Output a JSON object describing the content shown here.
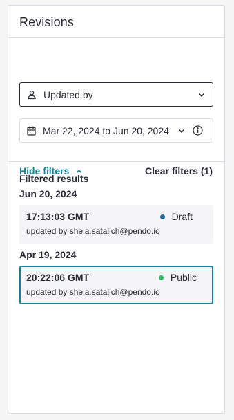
{
  "panel": {
    "title": "Revisions"
  },
  "filters": {
    "updated_by": {
      "label": "Updated by",
      "icon": "user-icon"
    },
    "date_range": {
      "label": "Mar 22, 2024 to Jun 20, 2024",
      "icon": "calendar-icon"
    },
    "hide_filters_label": "Hide filters",
    "clear_filters_label": "Clear filters (1)",
    "accent_color": "#128297"
  },
  "results": {
    "heading": "Filtered results",
    "groups": [
      {
        "date": "Jun 20, 2024",
        "revisions": [
          {
            "time": "17:13:03 GMT",
            "status": "Draft",
            "status_color": "#1f6b9a",
            "user": "updated by shela.satalich@pendo.io"
          }
        ]
      },
      {
        "date": "Apr 19, 2024",
        "revisions": [
          {
            "time": "20:22:06 GMT",
            "status": "Public",
            "status_color": "#2ebd6b",
            "user": "updated by shela.satalich@pendo.io",
            "selected": true
          }
        ]
      }
    ]
  }
}
